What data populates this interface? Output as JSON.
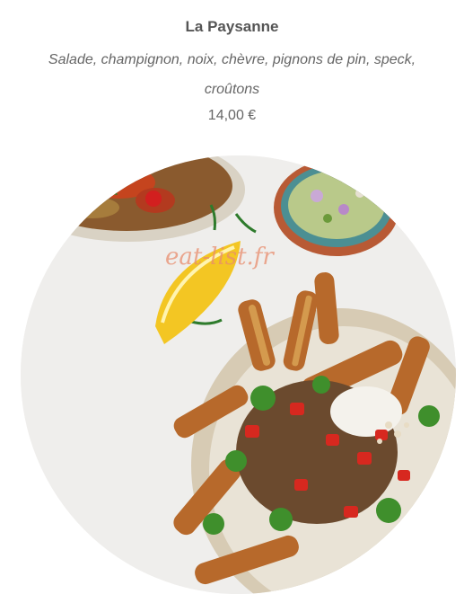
{
  "item": {
    "name": "La Paysanne",
    "description": "Salade, champignon, noix, chèvre, pignons de pin, speck, croûtons",
    "price": "14,00 €"
  },
  "photo": {
    "watermark": "eat-list.fr",
    "subject": "salad-bowl-with-sweet-potato-fries"
  },
  "colors": {
    "title": "#555555",
    "text": "#666666",
    "watermark": "#e88c6e"
  }
}
